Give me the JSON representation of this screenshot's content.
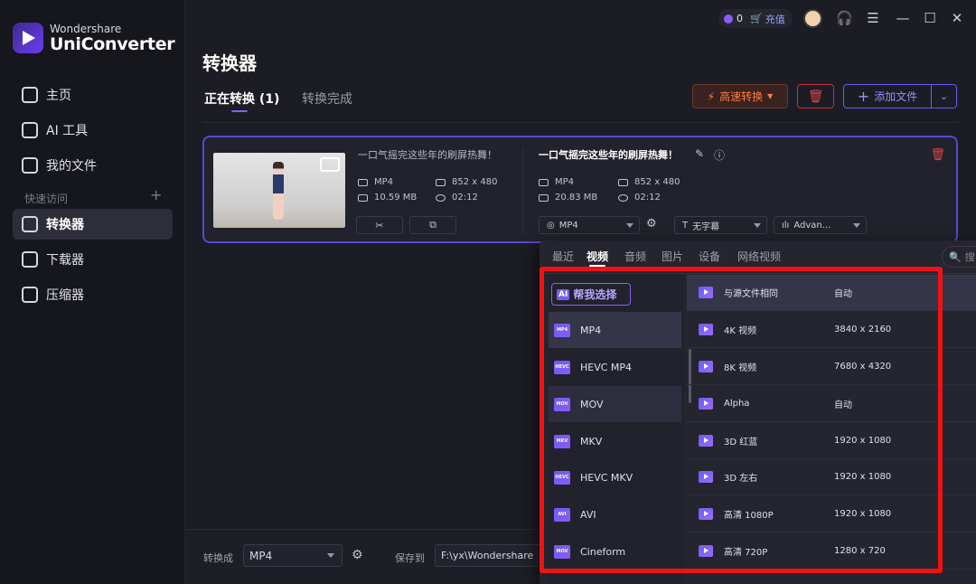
{
  "brand": {
    "small": "Wondershare",
    "big": "UniConverter"
  },
  "topbar": {
    "credits": "0",
    "recharge": "充值"
  },
  "sidebar": {
    "items": [
      {
        "label": "主页",
        "icon": "home-icon"
      },
      {
        "label": "AI 工具",
        "icon": "ai-tools-icon"
      },
      {
        "label": "我的文件",
        "icon": "file-icon"
      }
    ],
    "quick_access": "快速访问",
    "quick_items": [
      {
        "label": "转换器",
        "icon": "converter-icon",
        "active": true
      },
      {
        "label": "下载器",
        "icon": "download-icon"
      },
      {
        "label": "压缩器",
        "icon": "compress-icon"
      }
    ]
  },
  "main": {
    "title": "转换器",
    "tabs": [
      {
        "label": "正在转换 (1)"
      },
      {
        "label": "转换完成"
      }
    ],
    "fast_convert": "高速转换",
    "add_file": "添加文件"
  },
  "file": {
    "source_title": "一口气摇完这些年的刷屏热舞！",
    "target_title": "一口气摇完这些年的刷屏热舞！",
    "source": {
      "format": "MP4",
      "resolution": "852 x 480",
      "size": "10.59 MB",
      "duration": "02:12"
    },
    "target": {
      "format": "MP4",
      "resolution": "852 x 480",
      "size": "20.83 MB",
      "duration": "02:12"
    },
    "output_format": "MP4",
    "subtitle": "无字幕",
    "audio": "Advan..."
  },
  "bottom": {
    "convert_to_label": "转换成",
    "convert_to_value": "MP4",
    "save_to_label": "保存到",
    "save_to_value": "F:\\yx\\Wondershare"
  },
  "popup": {
    "tabs": [
      "最近",
      "视频",
      "音频",
      "图片",
      "设备",
      "网络视频"
    ],
    "search_placeholder": "搜",
    "ai_button": "帮我选择",
    "ai_badge": "AI",
    "formats": [
      {
        "name": "MP4",
        "icon_text": "MP4"
      },
      {
        "name": "HEVC MP4",
        "icon_text": "HEVC"
      },
      {
        "name": "MOV",
        "icon_text": "MOV"
      },
      {
        "name": "MKV",
        "icon_text": "MKV"
      },
      {
        "name": "HEVC MKV",
        "icon_text": "HEVC"
      },
      {
        "name": "AVI",
        "icon_text": "AVI"
      },
      {
        "name": "Cineform",
        "icon_text": "MOV"
      }
    ],
    "presets": [
      {
        "name": "与源文件相同",
        "res": "自动"
      },
      {
        "name": "4K 视频",
        "res": "3840 x 2160"
      },
      {
        "name": "8K 视频",
        "res": "7680 x 4320"
      },
      {
        "name": "Alpha",
        "res": "自动"
      },
      {
        "name": "3D 红蓝",
        "res": "1920 x 1080"
      },
      {
        "name": "3D 左右",
        "res": "1920 x 1080"
      },
      {
        "name": "高清 1080P",
        "res": "1920 x 1080"
      },
      {
        "name": "高清 720P",
        "res": "1280 x 720"
      }
    ]
  },
  "colors": {
    "accent": "#6a5df4",
    "highlight_box": "#f01212",
    "danger": "#e0444e",
    "fast": "#ff7a3d"
  }
}
